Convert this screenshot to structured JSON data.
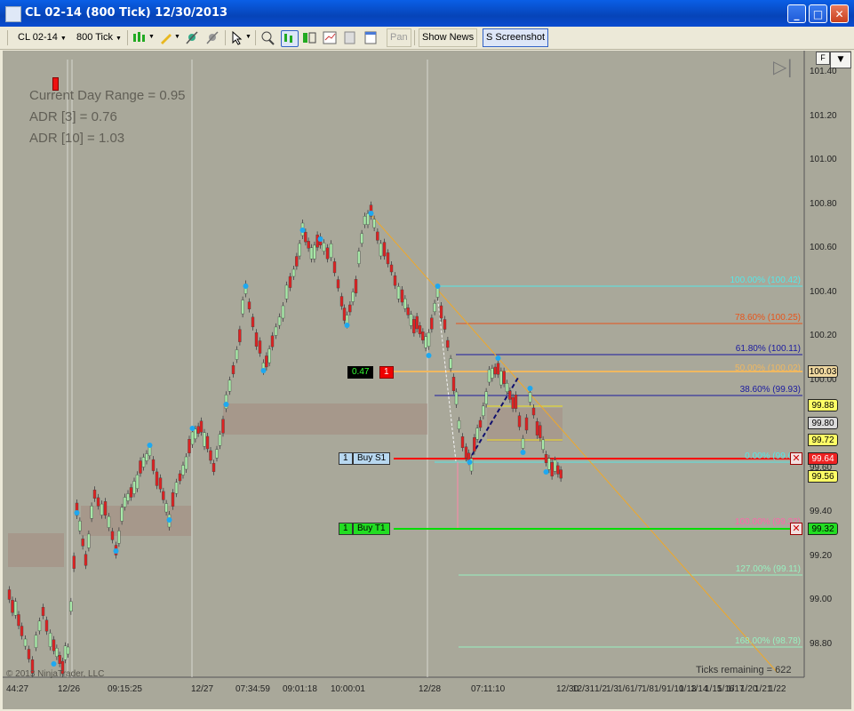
{
  "window": {
    "title": "CL 02-14 (800 Tick)  12/30/2013",
    "minimize": "_",
    "maximize": "□",
    "close": "✕"
  },
  "toolbar": {
    "instrument": "CL 02-14",
    "period": "800 Tick",
    "dropdown_glyph": "▼",
    "pan_label": "Pan",
    "show_news_label": "Show News",
    "screenshot_label": "S Screenshot"
  },
  "chart_panel": {
    "f_button": "F",
    "arrow_button": "▼",
    "play_glyph": "▷|"
  },
  "stats": {
    "current_day_range": "Current Day Range = 0.95",
    "adr3": "ADR [3] = 0.76",
    "adr10": "ADR [10] = 1.03"
  },
  "footer": {
    "copyright": "© 2013 NinjaTrader, LLC",
    "ticks_remaining": "Ticks remaining = 622"
  },
  "colors": {
    "background": "#a9a89a",
    "up_candle": "#a8e8a8",
    "down_candle": "#dd2222",
    "order_stop": "#ff0000",
    "order_target": "#00dd00"
  },
  "y_axis": [
    "101.40",
    "101.20",
    "101.00",
    "100.80",
    "100.60",
    "100.40",
    "100.20",
    "100.00",
    "99.80",
    "99.60",
    "99.40",
    "99.20",
    "99.00",
    "98.80"
  ],
  "x_axis": [
    "44:27",
    "12/26",
    "09:15:25",
    "12/27",
    "07:34:59",
    "09:01:18",
    "10:00:01",
    "12/28",
    "07:11:10",
    "12/30",
    "12/31",
    "1/2",
    "1/3",
    "1/6",
    "1/7",
    "1/8",
    "1/9",
    "1/10",
    "1/13",
    "1/14",
    "1/15",
    "1/16",
    "1/17",
    "1/20",
    "1/21",
    "1/22"
  ],
  "fib_levels": [
    {
      "label": "100.00% (100.42)",
      "color": "#55e8e8"
    },
    {
      "label": "78.60% (100.25)",
      "color": "#e8541a"
    },
    {
      "label": "61.80% (100.11)",
      "color": "#1a1aa0"
    },
    {
      "label": "50.00% (100.02)",
      "color": "#f0b860"
    },
    {
      "label": "38.60% (99.93)",
      "color": "#1a1aa0"
    },
    {
      "label": "0.00% (99.62)",
      "color": "#55e8e8"
    },
    {
      "label": "100.00% (99.32)",
      "color": "#ff66aa"
    },
    {
      "label": "127.00% (99.11)",
      "color": "#98f0c0"
    },
    {
      "label": "168.00% (98.78)",
      "color": "#98f0c0"
    }
  ],
  "price_tags": [
    {
      "text": "100.03",
      "bg": "#f0d8a0"
    },
    {
      "text": "99.88",
      "bg": "#ffff66"
    },
    {
      "text": "99.80",
      "bg": "#dcdcdc"
    },
    {
      "text": "99.72",
      "bg": "#ffff66"
    },
    {
      "text": "99.64",
      "bg": "#ee2222"
    },
    {
      "text": "99.56",
      "bg": "#ffff66"
    },
    {
      "text": "99.32",
      "bg": "#22dd22"
    }
  ],
  "orders": {
    "pnl_value": "0.47",
    "pnl_qty": "1",
    "stop_qty": "1",
    "stop_label": "Buy S1",
    "target_qty": "1",
    "target_label": "Buy T1",
    "cancel_glyph": "✕"
  }
}
